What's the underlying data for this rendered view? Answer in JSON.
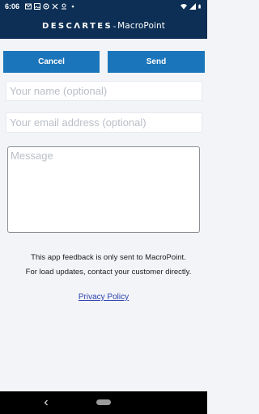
{
  "status_bar": {
    "time": "6:06",
    "left_icons": [
      "mail-icon",
      "photo-icon",
      "sync-icon",
      "tools-icon",
      "location-icon",
      "dot-icon"
    ],
    "right_icons": [
      "wifi-icon",
      "signal-icon",
      "battery-icon"
    ]
  },
  "header": {
    "brand": "DESCΛRTES",
    "trademark": "™",
    "product": "MacroPoint"
  },
  "actions": {
    "cancel_label": "Cancel",
    "send_label": "Send"
  },
  "form": {
    "name_placeholder": "Your name (optional)",
    "name_value": "",
    "email_placeholder": "Your email address (optional)",
    "email_value": "",
    "message_placeholder": "Message",
    "message_value": ""
  },
  "info": {
    "line1": "This app feedback is only sent to MacroPoint.",
    "line2": "For load updates, contact your customer directly."
  },
  "privacy_link": "Privacy Policy",
  "colors": {
    "header_bg": "#0d2f55",
    "button_bg": "#1b75bb",
    "link": "#2b3fae",
    "page_bg": "#f2f4f7"
  }
}
